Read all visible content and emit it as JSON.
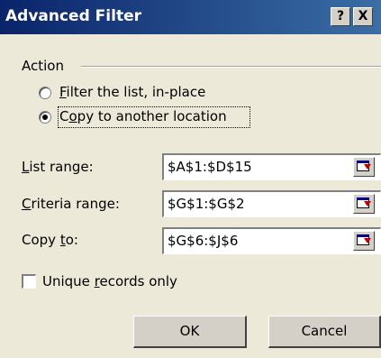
{
  "window": {
    "title": "Advanced Filter",
    "help_label": "?",
    "close_label": "X"
  },
  "action_group": {
    "label": "Action",
    "options": [
      {
        "mnemonic": "F",
        "rest": "ilter the list, in-place",
        "selected": false
      },
      {
        "mnemonic": "o",
        "prefix": "C",
        "rest": "py to another location",
        "selected": true
      }
    ]
  },
  "fields": {
    "list_range": {
      "label_mnemonic": "L",
      "label_rest": "ist range:",
      "value": "$A$1:$D$15"
    },
    "criteria_range": {
      "label_mnemonic": "C",
      "label_rest": "riteria range:",
      "value": "$G$1:$G$2"
    },
    "copy_to": {
      "label_prefix": "Copy ",
      "label_mnemonic": "t",
      "label_rest": "o:",
      "value": "$G$6:$J$6"
    }
  },
  "unique_records": {
    "label_prefix": "Unique ",
    "label_mnemonic": "r",
    "label_rest": "ecords only",
    "checked": false
  },
  "buttons": {
    "ok": "OK",
    "cancel": "Cancel"
  },
  "icons": {
    "collapse": "collapse-dialog-icon"
  }
}
